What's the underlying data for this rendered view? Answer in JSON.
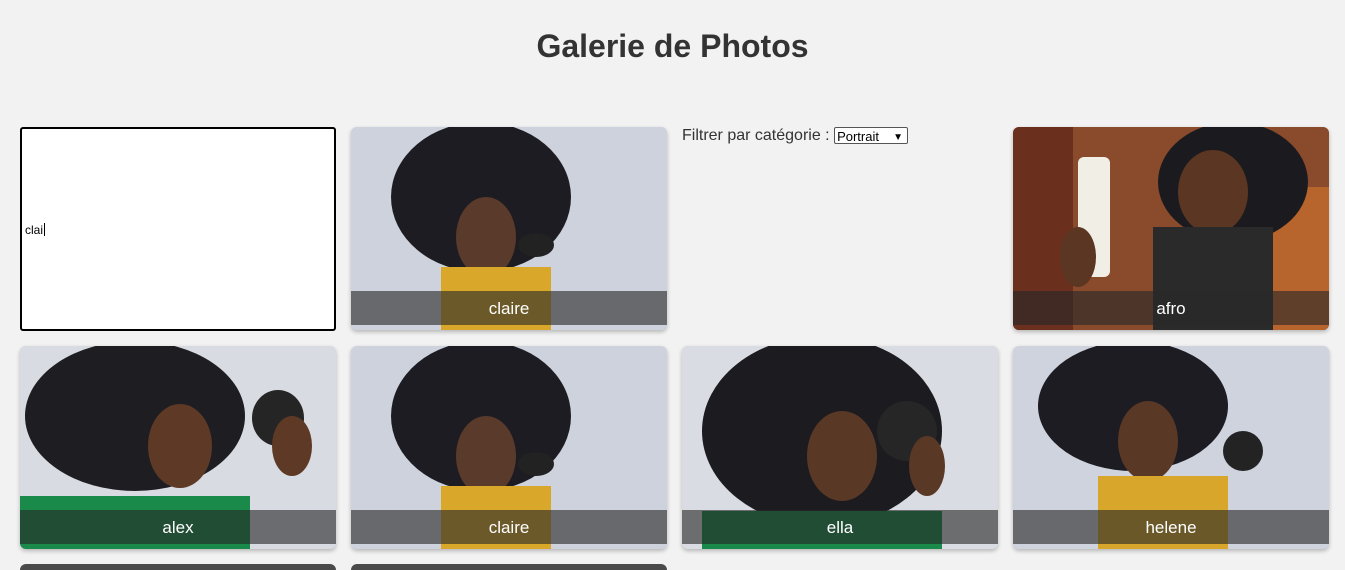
{
  "page": {
    "title": "Galerie de Photos"
  },
  "search": {
    "value": "clai"
  },
  "filter": {
    "label": "Filtrer par catégorie :",
    "selected": "Portrait"
  },
  "photos": [
    {
      "name": "claire",
      "subject": "woman-afro-yellow-top-holding-jar",
      "bg": "#c9cfdc"
    },
    {
      "name": "afro",
      "subject": "woman-glasses-holding-bottle",
      "bg": "#7a3b25"
    },
    {
      "name": "alex",
      "subject": "woman-green-top-holding-jar",
      "bg": "#d8dbe0"
    },
    {
      "name": "claire",
      "subject": "woman-afro-yellow-top-holding-jar",
      "bg": "#c9cfdc"
    },
    {
      "name": "ella",
      "subject": "woman-green-top-jar-by-face",
      "bg": "#d9dce2"
    },
    {
      "name": "helene",
      "subject": "woman-yellow-top-holding-jar",
      "bg": "#cdd2de"
    }
  ]
}
